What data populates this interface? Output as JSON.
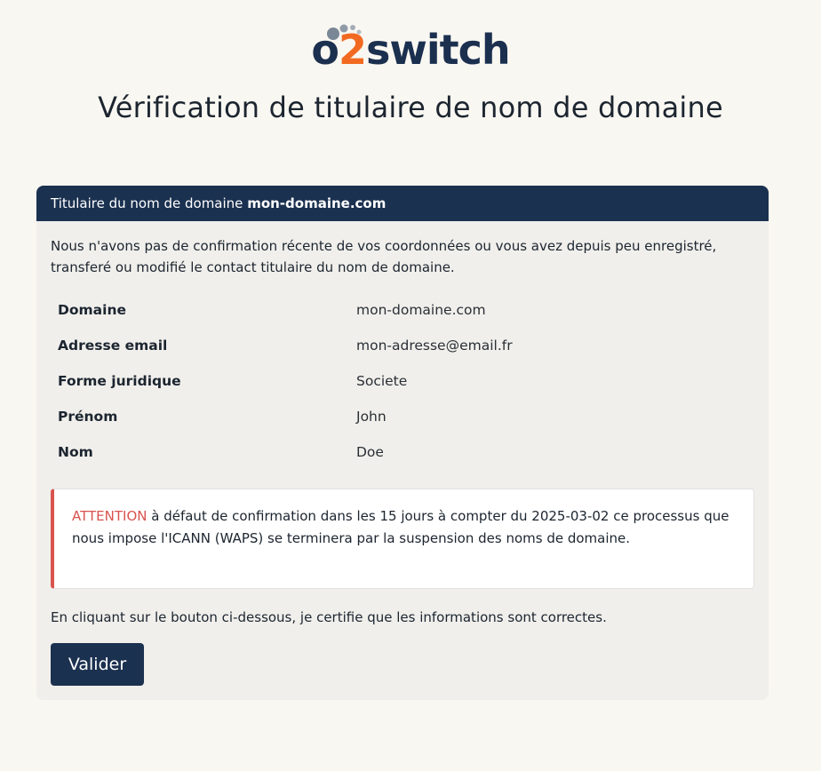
{
  "logo": {
    "prefix": "o",
    "two": "2",
    "suffix": "switch"
  },
  "page_title": "Vérification de titulaire de nom de domaine",
  "card": {
    "header_prefix": "Titulaire du nom de domaine",
    "header_domain": "mon-domaine.com",
    "intro": "Nous n'avons pas de confirmation récente de vos coordonnées ou vous avez depuis peu enregistré, transferé ou modifié le contact titulaire du nom de domaine.",
    "rows": [
      {
        "label": "Domaine",
        "value": "mon-domaine.com"
      },
      {
        "label": "Adresse email",
        "value": "mon-adresse@email.fr"
      },
      {
        "label": "Forme juridique",
        "value": "Societe"
      },
      {
        "label": "Prénom",
        "value": "John"
      },
      {
        "label": "Nom",
        "value": "Doe"
      }
    ],
    "alert": {
      "strong": "ATTENTION",
      "text": " à défaut de confirmation dans les 15 jours à compter du 2025-03-02 ce processus que nous impose l'ICANN (WAPS) se terminera par la suspension des noms de domaine."
    },
    "certify": "En cliquant sur le bouton ci-dessous, je certifie que les informations sont correctes.",
    "button_label": "Valider"
  },
  "colors": {
    "navy": "#1b3150",
    "accent_orange": "#f26a21",
    "alert_red": "#d9534f",
    "background": "#f9f7f1"
  }
}
